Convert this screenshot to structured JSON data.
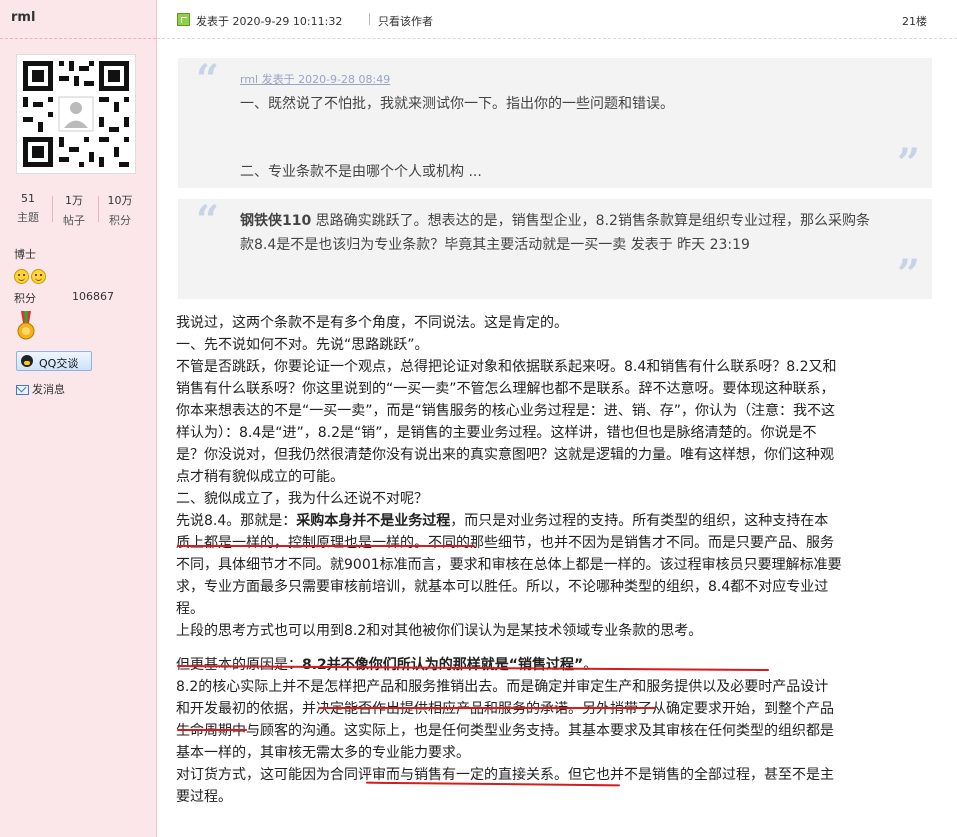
{
  "user": {
    "name": "rml",
    "stats": [
      {
        "num": "51",
        "label": "主题"
      },
      {
        "num": "1万",
        "label": "帖子"
      },
      {
        "num": "10万",
        "label": "积分"
      }
    ],
    "rank": "博士",
    "points_label": "积分",
    "points_value": "106867",
    "qq_label": "QQ交谈",
    "message_label": "发消息"
  },
  "post": {
    "time": "发表于 2020-9-29 10:11:32",
    "only_author": "只看该作者",
    "floor": "21楼"
  },
  "quote1": {
    "header": "rml 发表于 2020-9-28 08:49",
    "line1": "一、既然说了不怕批，我就来测试你一下。指出你的一些问题和错误。",
    "line2": "二、专业条款不是由哪个个人或机构 ..."
  },
  "quote2": {
    "author": "钢铁侠110",
    "text": " 思路确实跳跃了。想表达的是，销售型企业，8.2销售条款算是组织专业过程，那么采购条款8.4是不是也该归为专业条款？毕竟其主要活动就是一买一卖  发表于 昨天 23:19"
  },
  "body": {
    "l1": "我说过，这两个条款不是有多个角度，不同说法。这是肯定的。",
    "l2": "一、先不说如何不对。先说“思路跳跃”。",
    "l3": "不管是否跳跃，你要论证一个观点，总得把论证对象和依据联系起来呀。8.4和销售有什么联系呀？8.2又和",
    "l4": "销售有什么联系呀？你这里说到的“一买一卖”不管怎么理解也都不是联系。辞不达意呀。要体现这种联系，",
    "l5": "你本来想表达的不是“一买一卖”，而是“销售服务的核心业务过程是：进、销、存”，你认为（注意：我不这",
    "l6": "样认为）：8.4是“进”，8.2是“销”，是销售的主要业务过程。这样讲，错也但也是脉络清楚的。你说是不",
    "l7": "是？你没说对，但我仍然很清楚你没有说出来的真实意图吧？这就是逻辑的力量。唯有这样想，你们这种观",
    "l8": "点才稍有貌似成立的可能。",
    "l9": "二、貌似成立了，我为什么还说不对呢？",
    "l10a": "先说8.4。那就是：",
    "l10b": "采购本身并不是业务过程",
    "l10c": "，而只是对业务过程的支持。所有类型的组织，这种支持在本",
    "l11": "质上都是一样的，控制原理也是一样的。不同的那些细节，也并不因为是销售才不同。而是只要产品、服务",
    "l12": "不同，具体细节才不同。就9001标准而言，要求和审核在总体上都是一样的。该过程审核员只要理解标准要",
    "l13": "求，专业方面最多只需要审核前培训，就基本可以胜任。所以，不论哪种类型的组织，8.4都不对应专业过",
    "l14": "程。",
    "l15": "上段的思考方式也可以用到8.2和对其他被你们误认为是某技术领域专业条款的思考。",
    "l16a": "但更基本的原因是：",
    "l16b": "8.2并不像你们所认为的那样就是“销售过程”",
    "l16c": "。",
    "l17": "8.2的核心实际上并不是怎样把产品和服务推销出去。而是确定并审定生产和服务提供以及必要时产品设计",
    "l18": "和开发最初的依据，并决定能否作出提供相应产品和服务的承诺。另外捎带了从确定要求开始，到整个产品",
    "l19": "生命周期中与顾客的沟通。这实际上，也是任何类型业务支持。其基本要求及其审核在任何类型的组织都是",
    "l20": "基本一样的，其审核无需太多的专业能力要求。",
    "l21": "对订货方式，这可能因为合同评审而与销售有一定的直接关系。但它也并不是销售的全部过程，甚至不是主",
    "l22": "要过程。"
  },
  "colors": {
    "sidebar_bg": "#fbe7ea",
    "underline_red": "#d61c1c",
    "quote_bg": "#f3f3f3"
  }
}
